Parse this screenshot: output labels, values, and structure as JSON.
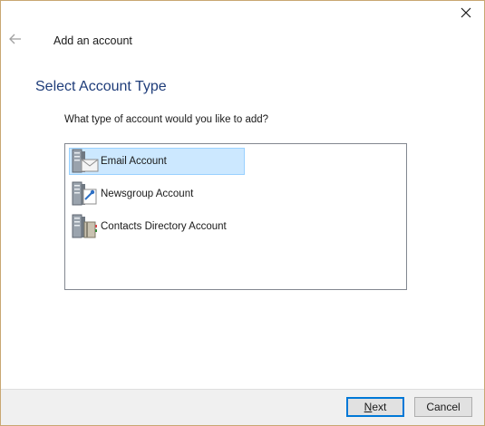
{
  "window": {
    "title": "Add an account",
    "close_label": "Close",
    "back_label": "Back"
  },
  "page": {
    "heading": "Select Account Type",
    "prompt": "What type of account would you like to add?"
  },
  "account_types": [
    {
      "label": "Email Account",
      "icon": "email-server-icon",
      "selected": true
    },
    {
      "label": "Newsgroup Account",
      "icon": "newsgroup-server-icon",
      "selected": false
    },
    {
      "label": "Contacts Directory Account",
      "icon": "directory-server-icon",
      "selected": false
    }
  ],
  "footer": {
    "next_mnemonic": "N",
    "next_rest": "ext",
    "cancel_label": "Cancel"
  },
  "colors": {
    "heading": "#1f3d7a",
    "selection_bg": "#cce8ff",
    "selection_border": "#99d1ff",
    "default_button_border": "#0078d7",
    "window_border": "#c9a772"
  }
}
